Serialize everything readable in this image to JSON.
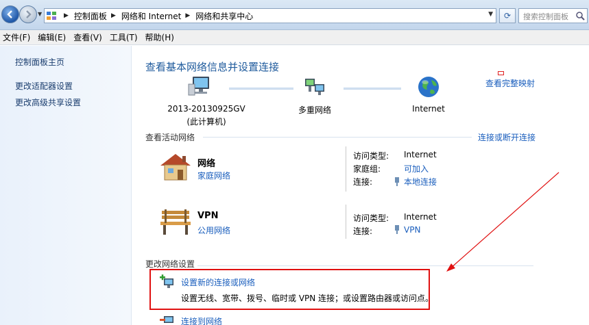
{
  "addressbar": {
    "breadcrumbs": [
      "控制面板",
      "网络和 Internet",
      "网络和共享中心"
    ],
    "search_placeholder": "搜索控制面板"
  },
  "menu": [
    "文件(F)",
    "编辑(E)",
    "查看(V)",
    "工具(T)",
    "帮助(H)"
  ],
  "sidebar": {
    "items": [
      {
        "label": "控制面板主页"
      },
      {
        "label": "更改适配器设置"
      },
      {
        "label": "更改高级共享设置"
      }
    ]
  },
  "main": {
    "title": "查看基本网络信息并设置连接",
    "full_map_link": "查看完整映射",
    "map": {
      "computer_name": "2013-20130925GV",
      "computer_note": "(此计算机)",
      "middle": "多重网络",
      "internet": "Internet"
    },
    "active_section": "查看活动网络",
    "connect_link": "连接或断开连接",
    "networks": [
      {
        "name": "网络",
        "type": "家庭网络",
        "access_key": "访问类型:",
        "access_value": "Internet",
        "homegroup_key": "家庭组:",
        "homegroup_value": "可加入",
        "conn_key": "连接:",
        "conn_value": "本地连接"
      },
      {
        "name": "VPN",
        "type": "公用网络",
        "access_key": "访问类型:",
        "access_value": "Internet",
        "conn_key": "连接:",
        "conn_value": "VPN"
      }
    ],
    "change_section": "更改网络设置",
    "tasks": [
      {
        "title": "设置新的连接或网络",
        "desc": "设置无线、宽带、拨号、临时或 VPN 连接；或设置路由器或访问点。"
      },
      {
        "title": "连接到网络"
      }
    ]
  },
  "colors": {
    "link": "#1a5ebd",
    "title": "#1e5a9c",
    "highlight": "#e01010"
  }
}
